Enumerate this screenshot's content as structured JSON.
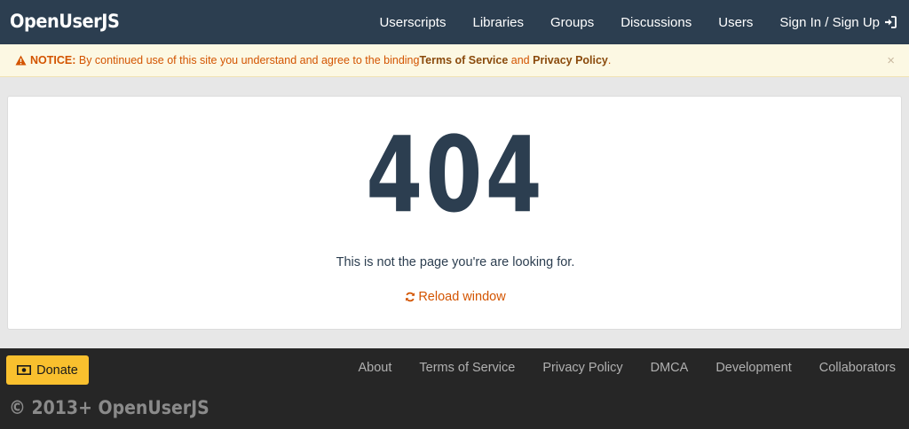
{
  "navbar": {
    "brand": "OpenUserJS",
    "links": [
      "Userscripts",
      "Libraries",
      "Groups",
      "Discussions",
      "Users"
    ],
    "signin_label": "Sign In / Sign Up"
  },
  "notice": {
    "label": "NOTICE:",
    "text": " By continued use of this site you understand and agree to the binding",
    "tos_link": "Terms of Service",
    "and_text": " and ",
    "privacy_link": "Privacy Policy",
    "end": ".",
    "close": "×"
  },
  "main": {
    "code": "404",
    "message": "This is not the page you're are looking for.",
    "reload_label": "Reload window"
  },
  "footer": {
    "donate_label": "Donate",
    "links": [
      "About",
      "Terms of Service",
      "Privacy Policy",
      "DMCA",
      "Development",
      "Collaborators"
    ],
    "copyright": "© 2013+ OpenUserJS"
  },
  "colors": {
    "navbar_bg": "#2c3e50",
    "accent": "#d35400",
    "donate_bg": "#f9c02e",
    "footer_bg": "#262626"
  }
}
